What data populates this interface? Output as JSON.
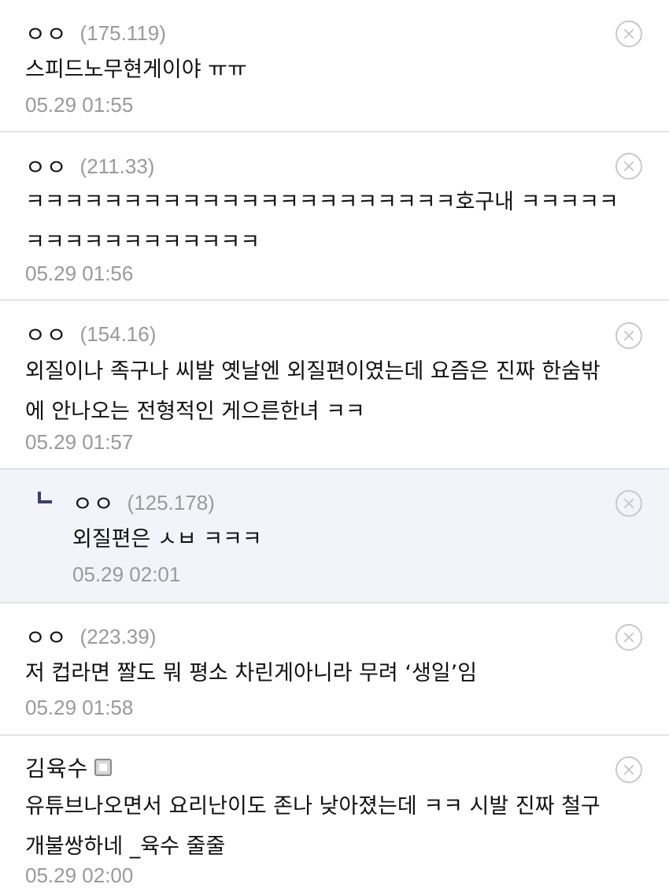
{
  "comments": [
    {
      "nick": "ㅇㅇ",
      "ip": "(175.119)",
      "text": "스피드노무현게이야 ㅠㅠ",
      "date": "05.29 01:55",
      "reply": false
    },
    {
      "nick": "ㅇㅇ",
      "ip": "(211.33)",
      "text": "ㅋㅋㅋㅋㅋㅋㅋㅋㅋㅋㅋㅋㅋㅋㅋㅋㅋㅋㅋㅋㅋㅋ호구내 ㅋㅋㅋㅋㅋ\nㅋㅋㅋㅋㅋㅋㅋㅋㅋㅋㅋㅋ",
      "date": "05.29 01:56",
      "reply": false
    },
    {
      "nick": "ㅇㅇ",
      "ip": "(154.16)",
      "text": "외질이나 족구나 씨발 옛날엔 외질편이였는데 요즘은 진짜 한숨밖\n에 안나오는 전형적인 게으른한녀 ㅋㅋ",
      "date": "05.29 01:57",
      "reply": false
    },
    {
      "nick": "ㅇㅇ",
      "ip": "(125.178)",
      "text": "외질편은 ㅅㅂ ㅋㅋㅋ",
      "date": "05.29 02:01",
      "reply": true
    },
    {
      "nick": "ㅇㅇ",
      "ip": "(223.39)",
      "text": "저 컵라면 짤도 뭐 평소 차린게아니라 무려 ‘생일’임",
      "date": "05.29 01:58",
      "reply": false
    },
    {
      "nick": "김육수",
      "ip": "",
      "text": "유튜브나오면서 요리난이도 존나 낮아졌는데 ㅋㅋ 시발 진짜 철구\n개불쌍하네 _육수 줄줄",
      "date": "05.29 02:00",
      "reply": false,
      "member_icon": "fixed-member-icon"
    }
  ]
}
